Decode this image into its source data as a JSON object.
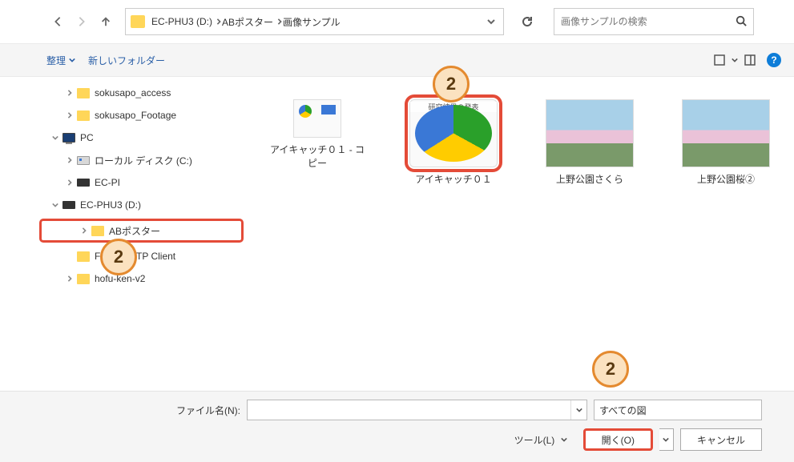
{
  "breadcrumb": [
    "EC-PHU3 (D:)",
    "ABポスター",
    "画像サンプル"
  ],
  "search": {
    "placeholder": "画像サンプルの検索"
  },
  "toolbar": {
    "organize": "整理",
    "new_folder": "新しいフォルダー"
  },
  "tree": [
    {
      "label": "sokusapo_access",
      "icon": "folder",
      "indent": 2,
      "expand": ">"
    },
    {
      "label": "sokusapo_Footage",
      "icon": "folder",
      "indent": 2,
      "expand": ">"
    },
    {
      "label": "PC",
      "icon": "pc",
      "indent": 1,
      "expand": "v"
    },
    {
      "label": "ローカル ディスク (C:)",
      "icon": "disk",
      "indent": 2,
      "expand": ">"
    },
    {
      "label": "EC-PI",
      "icon": "usb",
      "indent": 2,
      "expand": ">"
    },
    {
      "label": "EC-PHU3 (D:)",
      "icon": "usb",
      "indent": 1,
      "expand": "v"
    },
    {
      "label": "ABポスター",
      "icon": "folder",
      "indent": 2,
      "expand": ">",
      "selected": true
    },
    {
      "label": "FileZilla FTP Client",
      "icon": "folder",
      "indent": 2,
      "expand": ""
    },
    {
      "label": "hofu-ken-v2",
      "icon": "folder",
      "indent": 2,
      "expand": ">"
    }
  ],
  "files": [
    {
      "label": "アイキャッチ０１ - コピー",
      "thumb": "small-chart",
      "selected": false,
      "big": false
    },
    {
      "label": "アイキャッチ０１",
      "thumb": "chart",
      "caption": "研究結果の発表",
      "selected": true,
      "big": true
    },
    {
      "label": "上野公園さくら",
      "thumb": "photo",
      "selected": false,
      "big": true
    },
    {
      "label": "上野公園桜②",
      "thumb": "photo",
      "selected": false,
      "big": true
    }
  ],
  "footer": {
    "file_name_label": "ファイル名(N):",
    "filter": "すべての図",
    "tools": "ツール(L)",
    "open": "開く(O)",
    "cancel": "キャンセル"
  },
  "callouts": {
    "c1": "2",
    "c2": "2",
    "c3": "2"
  }
}
